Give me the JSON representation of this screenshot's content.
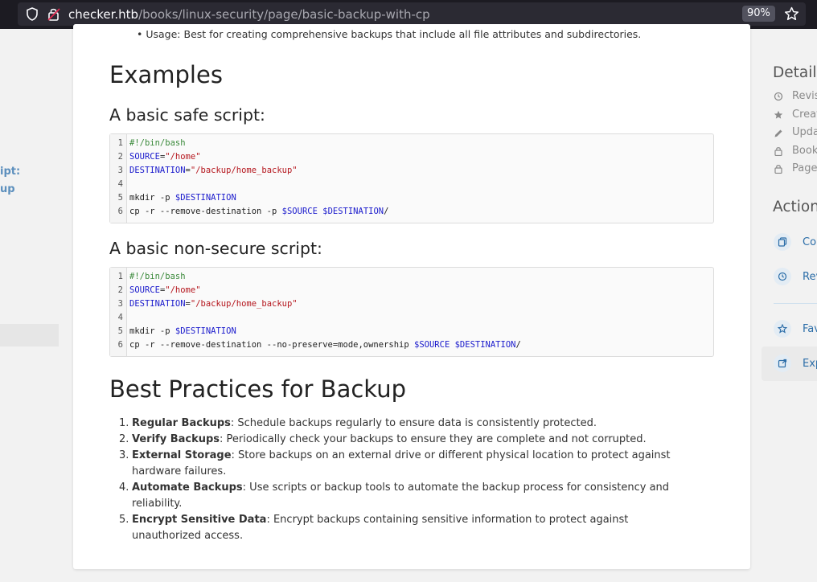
{
  "browser": {
    "url_host": "checker.htb",
    "url_path": "/books/linux-security/page/basic-backup-with-cp",
    "zoom": "90%"
  },
  "left_sidebar": {
    "items": [
      "ipt:",
      "up"
    ]
  },
  "content": {
    "usage_bullet": "Usage: Best for creating comprehensive backups that include all file attributes and subdirectories.",
    "examples_heading": "Examples",
    "safe_heading": "A basic safe script:",
    "safe_code": {
      "line_numbers": [
        "1",
        "2",
        "3",
        "4",
        "5",
        "6"
      ],
      "lines": [
        [
          {
            "t": "#!/bin/bash",
            "c": "cm"
          }
        ],
        [
          {
            "t": "SOURCE",
            "c": "vr"
          },
          {
            "t": "=",
            "c": ""
          },
          {
            "t": "\"/home\"",
            "c": "st"
          }
        ],
        [
          {
            "t": "DESTINATION",
            "c": "vr"
          },
          {
            "t": "=",
            "c": ""
          },
          {
            "t": "\"/backup/home_backup\"",
            "c": "st"
          }
        ],
        [],
        [
          {
            "t": "mkdir -p ",
            "c": ""
          },
          {
            "t": "$DESTINATION",
            "c": "vr"
          }
        ],
        [
          {
            "t": "cp -r --remove-destination -p ",
            "c": ""
          },
          {
            "t": "$SOURCE",
            "c": "vr"
          },
          {
            "t": " ",
            "c": ""
          },
          {
            "t": "$DESTINATION",
            "c": "vr"
          },
          {
            "t": "/",
            "c": ""
          }
        ]
      ]
    },
    "nonsecure_heading": "A basic non-secure script:",
    "nonsecure_code": {
      "line_numbers": [
        "1",
        "2",
        "3",
        "4",
        "5",
        "6"
      ],
      "lines": [
        [
          {
            "t": "#!/bin/bash",
            "c": "cm"
          }
        ],
        [
          {
            "t": "SOURCE",
            "c": "vr"
          },
          {
            "t": "=",
            "c": ""
          },
          {
            "t": "\"/home\"",
            "c": "st"
          }
        ],
        [
          {
            "t": "DESTINATION",
            "c": "vr"
          },
          {
            "t": "=",
            "c": ""
          },
          {
            "t": "\"/backup/home_backup\"",
            "c": "st"
          }
        ],
        [],
        [
          {
            "t": "mkdir -p ",
            "c": ""
          },
          {
            "t": "$DESTINATION",
            "c": "vr"
          }
        ],
        [
          {
            "t": "cp -r --remove-destination --no-preserve=mode,ownership ",
            "c": ""
          },
          {
            "t": "$SOURCE",
            "c": "vr"
          },
          {
            "t": " ",
            "c": ""
          },
          {
            "t": "$DESTINATION",
            "c": "vr"
          },
          {
            "t": "/",
            "c": ""
          }
        ]
      ]
    },
    "best_practices_heading": "Best Practices for Backup",
    "best_practices": [
      {
        "num": "1.",
        "title": "Regular Backups",
        "text": ": Schedule backups regularly to ensure data is consistently protected."
      },
      {
        "num": "2.",
        "title": "Verify Backups",
        "text": ": Periodically check your backups to ensure they are complete and not corrupted."
      },
      {
        "num": "3.",
        "title": "External Storage",
        "text": ": Store backups on an external drive or different physical location to protect against hardware failures."
      },
      {
        "num": "4.",
        "title": "Automate Backups",
        "text": ": Use scripts or backup tools to automate the backup process for consistency and reliability."
      },
      {
        "num": "5.",
        "title": "Encrypt Sensitive Data",
        "text": ": Encrypt backups containing sensitive information to protect against unauthorized access."
      }
    ]
  },
  "right_sidebar": {
    "details_heading": "Details",
    "details": [
      "Revis",
      "Creat",
      "Upda",
      "Book",
      "Page"
    ],
    "actions_heading": "Action",
    "actions": [
      "Cop",
      "Rev",
      "Fav",
      "Exp"
    ]
  }
}
